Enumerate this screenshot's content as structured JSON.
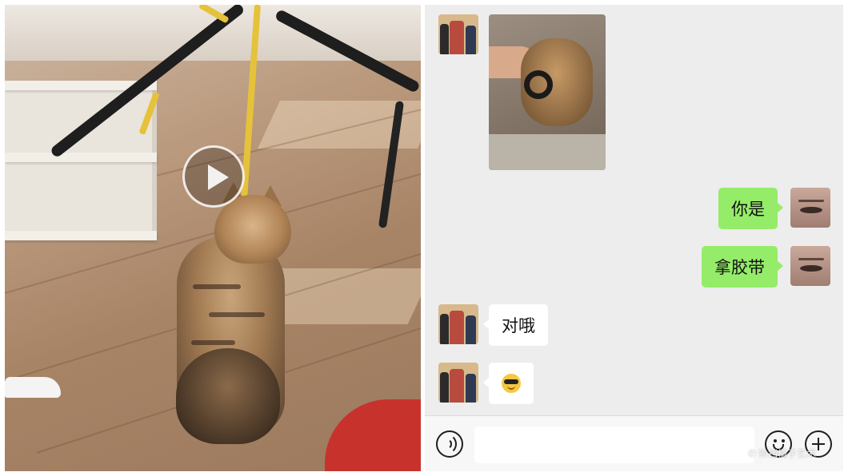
{
  "video": {
    "play_icon": "play-icon"
  },
  "chat": {
    "messages": [
      {
        "side": "left",
        "type": "image"
      },
      {
        "side": "right",
        "type": "text",
        "text": "你是"
      },
      {
        "side": "right",
        "type": "text",
        "text": "拿胶带"
      },
      {
        "side": "left",
        "type": "text",
        "text": "对哦"
      },
      {
        "side": "left",
        "type": "emoji",
        "emoji": "sunglasses-emoji"
      }
    ],
    "colors": {
      "background": "#ededed",
      "self_bubble": "#95ec69",
      "other_bubble": "#ffffff"
    }
  },
  "input_bar": {
    "voice_icon": "voice-icon",
    "emoji_icon": "emoji-icon",
    "plus_icon": "plus-icon",
    "input_value": ""
  },
  "watermark": {
    "text": "铃铛橘子艺术"
  }
}
